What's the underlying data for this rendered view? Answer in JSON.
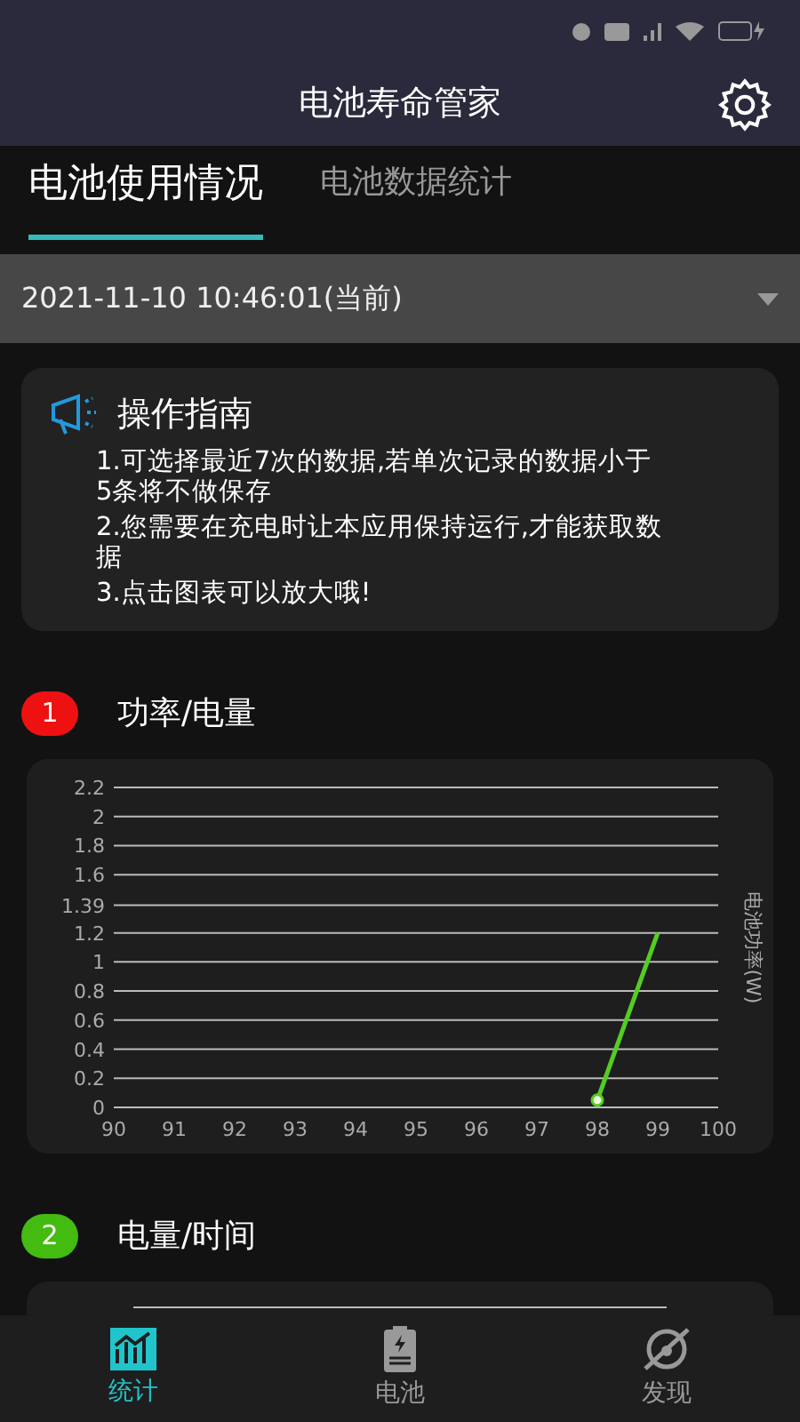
{
  "app_bar": {
    "title": "电池寿命管家"
  },
  "tabs": [
    {
      "label": "电池使用情况",
      "selected": true
    },
    {
      "label": "电池数据统计",
      "selected": false
    }
  ],
  "record_select": {
    "value": "2021-11-10 10:46:01(当前)"
  },
  "guide": {
    "title": "操作指南",
    "items": [
      "1.可选择最近7次的数据,若单次记录的数据小于5条将不做保存",
      "2.您需要在充电时让本应用保持运行,才能获取数据",
      "3.点击图表可以放大哦!"
    ]
  },
  "sections": [
    {
      "number": "1",
      "color": "#ee1111",
      "title": "功率/电量",
      "chart_data": {
        "type": "line",
        "ylabel": "电池功率(W)",
        "x": [
          98,
          99
        ],
        "series": [
          {
            "color": "#55cc22",
            "values": [
              0.05,
              1.2
            ]
          }
        ],
        "xlim": [
          90,
          100
        ],
        "ylim": [
          0,
          2.2
        ],
        "xticks": [
          90,
          91,
          92,
          93,
          94,
          95,
          96,
          97,
          98,
          99,
          100
        ],
        "yticks": [
          0,
          0.2,
          0.4,
          0.6,
          0.8,
          1,
          1.2,
          1.39,
          1.6,
          1.8,
          2,
          2.2
        ],
        "grid": true
      }
    },
    {
      "number": "2",
      "color": "#44bb11",
      "title": "电量/时间"
    }
  ],
  "bottom_nav": [
    {
      "label": "统计",
      "kind": "stats",
      "selected": true
    },
    {
      "label": "电池",
      "kind": "battery",
      "selected": false
    },
    {
      "label": "发现",
      "kind": "discover",
      "selected": false
    }
  ]
}
